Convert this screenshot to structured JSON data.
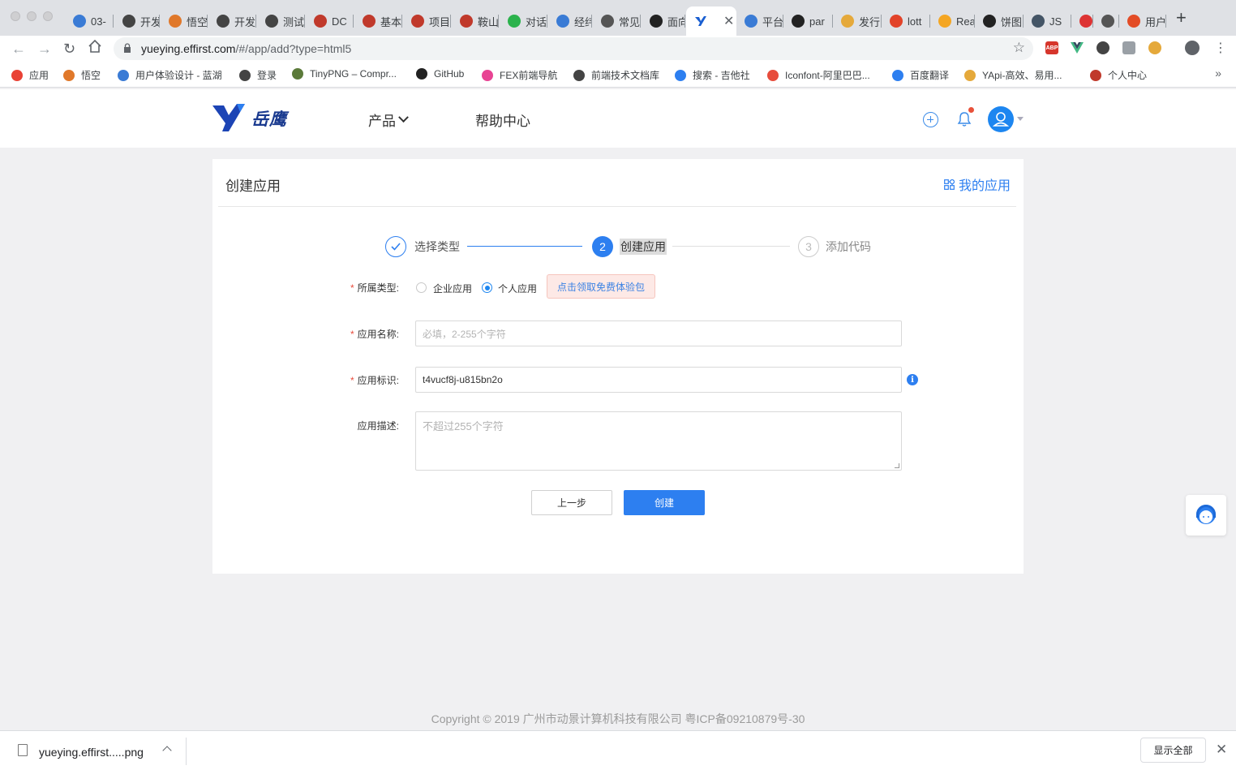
{
  "browser": {
    "tabs": [
      {
        "label": "03-",
        "color": "#3a7bd5"
      },
      {
        "label": "开发",
        "color": "#444"
      },
      {
        "label": "悟空",
        "color": "#e0782a"
      },
      {
        "label": "开发",
        "color": "#444"
      },
      {
        "label": "测试",
        "color": "#444"
      },
      {
        "label": "DC",
        "color": "#c0392b"
      },
      {
        "label": "基本",
        "color": "#c0392b"
      },
      {
        "label": "项目",
        "color": "#c0392b"
      },
      {
        "label": "鞍山",
        "color": "#c0392b"
      },
      {
        "label": "对话",
        "color": "#2bb24c"
      },
      {
        "label": "经纬",
        "color": "#3a7bd5"
      },
      {
        "label": "常见",
        "color": "#555"
      },
      {
        "label": "面向",
        "color": "#222"
      }
    ],
    "active_tab": {
      "label": "",
      "color": "#1a5fd1"
    },
    "tabs_right": [
      {
        "label": "平台",
        "color": "#3a7bd5"
      },
      {
        "label": "par",
        "color": "#222"
      },
      {
        "label": "发行",
        "color": "#e5a93b"
      },
      {
        "label": "lott",
        "color": "#e24329"
      },
      {
        "label": "Rea",
        "color": "#f4a623"
      },
      {
        "label": "饼图",
        "color": "#222"
      },
      {
        "label": "JS",
        "color": "#456"
      },
      {
        "label": "",
        "color": "#d33"
      },
      {
        "label": "",
        "color": "#555"
      },
      {
        "label": "用户",
        "color": "#e34c26"
      }
    ],
    "url_host": "yueying.effirst.com",
    "url_path": "/#/app/add?type=html5",
    "bookmarks": [
      {
        "label": "应用",
        "color": "#e94235"
      },
      {
        "label": "悟空",
        "color": "#e0782a"
      },
      {
        "label": "用户体验设计 - 蓝湖",
        "color": "#3a7bd5"
      },
      {
        "label": "登录",
        "color": "#444"
      },
      {
        "label": "TinyPNG – Compr...",
        "color": "#5b7a3a"
      },
      {
        "label": "GitHub",
        "color": "#222"
      },
      {
        "label": "FEX前端导航",
        "color": "#e84393"
      },
      {
        "label": "前端技术文档库",
        "color": "#444"
      },
      {
        "label": "搜索 - 吉他社",
        "color": "#2d7ff0"
      },
      {
        "label": "Iconfont-阿里巴巴...",
        "color": "#e74c3c"
      },
      {
        "label": "百度翻译",
        "color": "#2d7ff0"
      },
      {
        "label": "YApi-高效、易用...",
        "color": "#e5a93b"
      },
      {
        "label": "个人中心",
        "color": "#c0392b"
      }
    ]
  },
  "site": {
    "logo_text": "岳鹰",
    "nav": {
      "product": "产品",
      "help": "帮助中心"
    }
  },
  "page": {
    "title": "创建应用",
    "my_apps": "我的应用",
    "steps": [
      {
        "num": "1",
        "label": "选择类型",
        "state": "done"
      },
      {
        "num": "2",
        "label": "创建应用",
        "state": "active"
      },
      {
        "num": "3",
        "label": "添加代码",
        "state": "todo"
      }
    ],
    "form": {
      "type_label": "所属类型:",
      "type_options": [
        "企业应用",
        "个人应用"
      ],
      "type_selected": "个人应用",
      "promo": "点击领取免费体验包",
      "name_label": "应用名称:",
      "name_placeholder": "必填，2-255个字符",
      "id_label": "应用标识:",
      "id_value": "t4vucf8j-u815bn2o",
      "desc_label": "应用描述:",
      "desc_placeholder": "不超过255个字符",
      "prev": "上一步",
      "create": "创建"
    },
    "footer": "Copyright © 2019 广州市动景计算机科技有限公司 粤ICP备09210879号-30"
  },
  "downloads": {
    "file": "yueying.effirst.....png",
    "show_all": "显示全部"
  },
  "colors": {
    "accent": "#2d7ff0",
    "required": "#e84c3d"
  }
}
